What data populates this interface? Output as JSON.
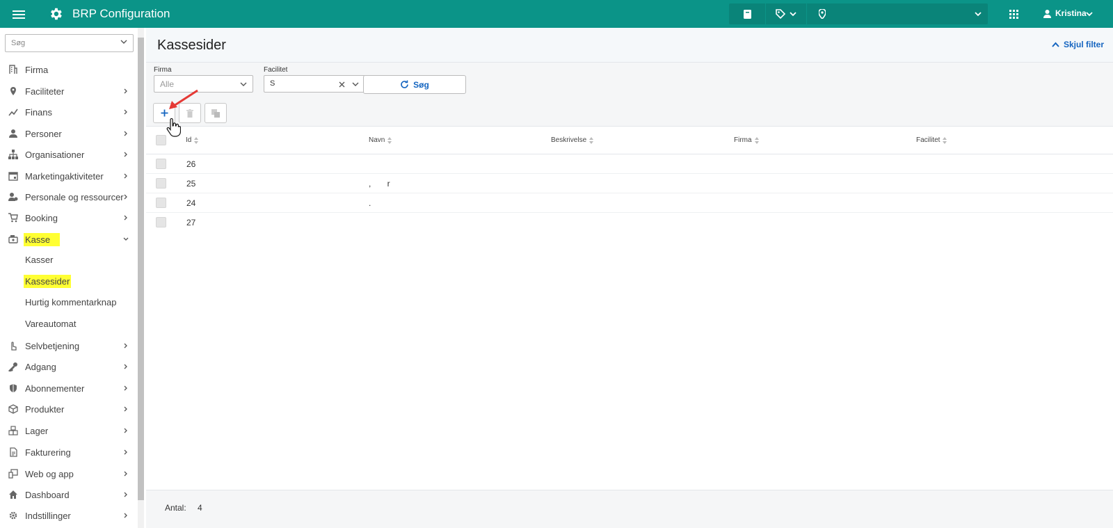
{
  "app": {
    "title": "BRP Configuration"
  },
  "topbar": {
    "user_name": "Kristina",
    "icons": [
      "menu-icon",
      "gear-icon",
      "book-icon",
      "tags-icon",
      "location-pin-icon",
      "apps-grid-icon",
      "user-icon"
    ]
  },
  "sidebar": {
    "search_placeholder": "Søg",
    "items": [
      {
        "label": "Firma",
        "icon": "building-icon",
        "has_children": false
      },
      {
        "label": "Faciliteter",
        "icon": "location-pin-icon",
        "has_children": true
      },
      {
        "label": "Finans",
        "icon": "chart-line-icon",
        "has_children": true
      },
      {
        "label": "Personer",
        "icon": "person-icon",
        "has_children": true
      },
      {
        "label": "Organisationer",
        "icon": "org-chart-icon",
        "has_children": true
      },
      {
        "label": "Marketingaktiviteter",
        "icon": "calendar-icon",
        "has_children": true
      },
      {
        "label": "Personale og ressourcer",
        "icon": "staff-icon",
        "has_children": true
      },
      {
        "label": "Booking",
        "icon": "cart-icon",
        "has_children": true
      },
      {
        "label": "Kasse",
        "icon": "cash-register-icon",
        "has_children": true,
        "expanded": true,
        "highlighted": true
      },
      {
        "label": "Selvbetjening",
        "icon": "hand-pointer-icon",
        "has_children": true
      },
      {
        "label": "Adgang",
        "icon": "key-icon",
        "has_children": true
      },
      {
        "label": "Abonnementer",
        "icon": "shield-icon",
        "has_children": true
      },
      {
        "label": "Produkter",
        "icon": "box-icon",
        "has_children": true
      },
      {
        "label": "Lager",
        "icon": "boxes-icon",
        "has_children": true
      },
      {
        "label": "Fakturering",
        "icon": "invoice-icon",
        "has_children": true
      },
      {
        "label": "Web og app",
        "icon": "devices-icon",
        "has_children": true
      },
      {
        "label": "Dashboard",
        "icon": "home-icon",
        "has_children": true
      },
      {
        "label": "Indstillinger",
        "icon": "gear-icon",
        "has_children": true
      }
    ],
    "kasse_children": [
      {
        "label": "Kasser",
        "highlighted": false
      },
      {
        "label": "Kassesider",
        "highlighted": true
      },
      {
        "label": "Hurtig kommentarknap",
        "highlighted": false
      },
      {
        "label": "Vareautomat",
        "highlighted": false
      }
    ]
  },
  "page": {
    "title": "Kassesider",
    "hide_filter_label": "Skjul filter"
  },
  "filters": {
    "firma_label": "Firma",
    "firma_value": "Alle",
    "facilitet_label": "Facilitet",
    "facilitet_value": "S",
    "search_button": "Søg"
  },
  "toolbar": {
    "add": "add-icon",
    "delete": "trash-icon",
    "copy": "copy-icon"
  },
  "table": {
    "columns": [
      "Id",
      "Navn",
      "Beskrivelse",
      "Firma",
      "Facilitet"
    ],
    "rows": [
      {
        "id": "26",
        "navn": "",
        "beskrivelse": "",
        "firma": "",
        "facilitet": ""
      },
      {
        "id": "25",
        "navn": ",       r",
        "beskrivelse": "",
        "firma": "",
        "facilitet": ""
      },
      {
        "id": "24",
        "navn": ".",
        "beskrivelse": "",
        "firma": "",
        "facilitet": ""
      },
      {
        "id": "27",
        "navn": "",
        "beskrivelse": "",
        "firma": "",
        "facilitet": ""
      }
    ]
  },
  "footer": {
    "count_label": "Antal:",
    "count_value": "4"
  },
  "colors": {
    "topbar": "#0b9488",
    "accent": "#1565c0",
    "highlight": "#ffff33",
    "annotation_arrow": "#e53935"
  }
}
